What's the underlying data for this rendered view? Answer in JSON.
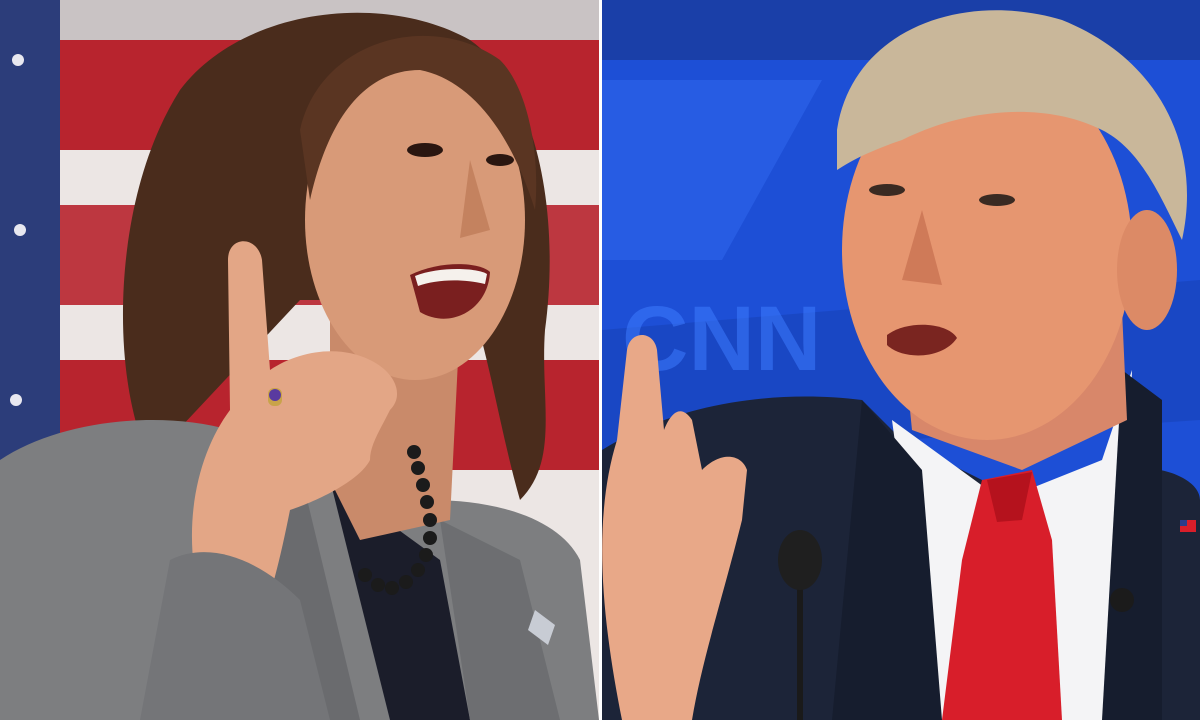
{
  "image": {
    "layout": "split-screen-two-photos",
    "left_photo": {
      "subject": "woman-speaking",
      "background": "american-flag",
      "colors": {
        "flag_red": "#b8242e",
        "flag_white": "#ece6e4",
        "flag_blue": "#2c3d7a",
        "suit": "#7d7e80",
        "hair": "#4a2c1c"
      }
    },
    "right_photo": {
      "subject": "man-speaking",
      "background": "blue-stage-backdrop",
      "backdrop_text": "CNN",
      "colors": {
        "backdrop": "#1d4fd6",
        "suit": "#1c2438",
        "shirt": "#f4f4f6",
        "tie": "#d81e2a",
        "hair": "#c9b79a"
      }
    }
  }
}
